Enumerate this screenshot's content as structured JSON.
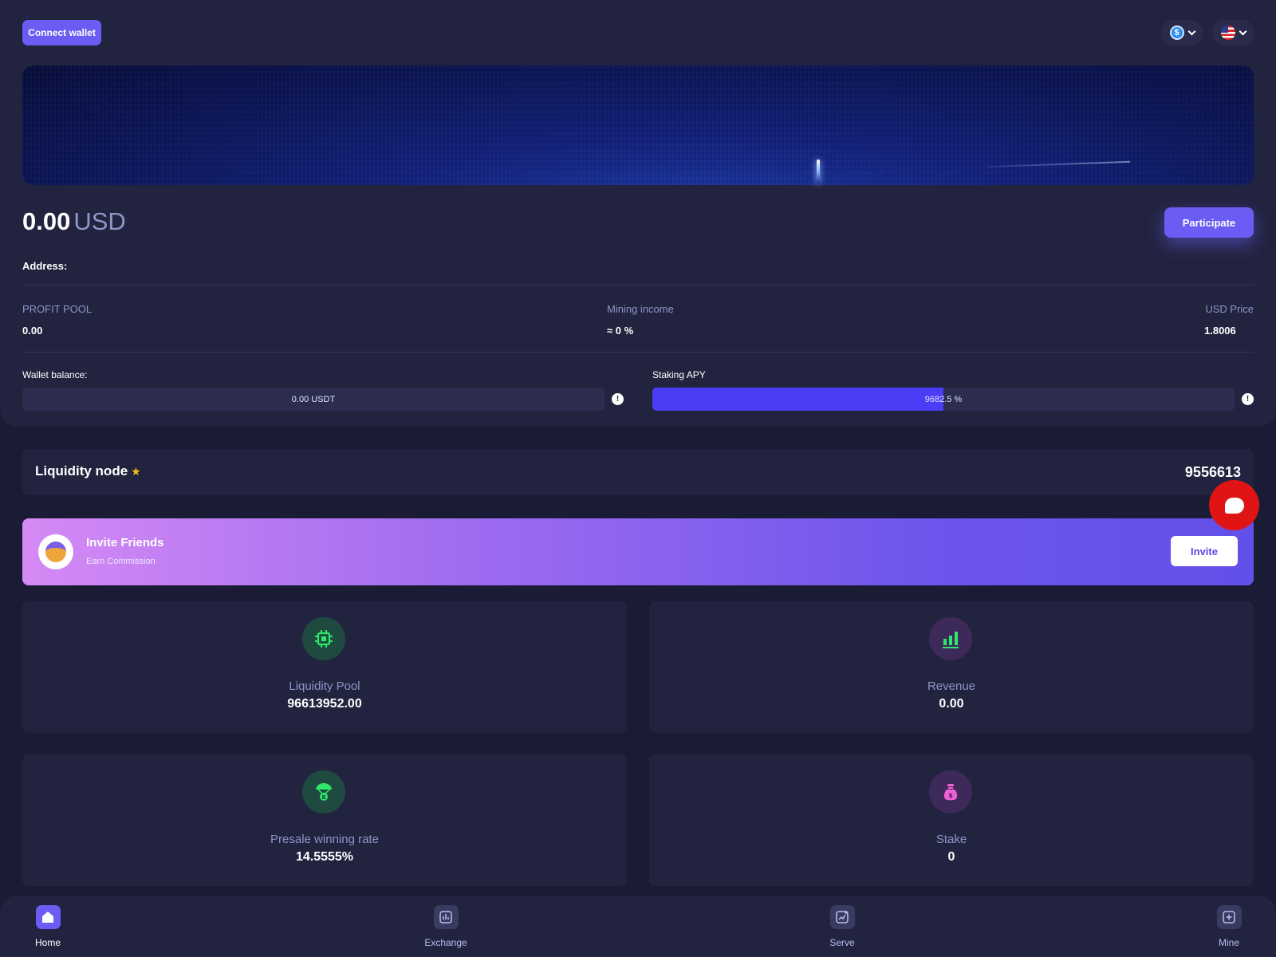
{
  "header": {
    "connect_wallet": "Connect wallet",
    "currency_icon": "dollar-coin-icon",
    "language_icon": "us-flag-icon"
  },
  "balance": {
    "amount": "0.00",
    "unit": "USD",
    "participate": "Participate"
  },
  "address_label": "Address:",
  "stats": {
    "profit_pool_label": "PROFIT POOL",
    "profit_pool_value": "0.00",
    "mining_income_label": "Mining income",
    "mining_income_value": "≈ 0 %",
    "usd_price_label": "USD Price",
    "usd_price_value": "1.8006"
  },
  "bars": {
    "wallet_label": "Wallet balance:",
    "wallet_value": "0.00 USDT",
    "wallet_fill_fraction": 0,
    "staking_label": "Staking APY",
    "staking_value": "9682.5 %",
    "staking_fill_fraction": 0.5
  },
  "node": {
    "title": "Liquidity node",
    "star": "★",
    "value": "9556613"
  },
  "invite": {
    "title": "Invite Friends",
    "subtitle": "Earn Commission",
    "button": "Invite"
  },
  "tiles": [
    {
      "label": "Liquidity Pool",
      "value": "96613952.00",
      "icon": "chip-icon"
    },
    {
      "label": "Revenue",
      "value": "0.00",
      "icon": "bar-chart-icon"
    },
    {
      "label": "Presale winning rate",
      "value": "14.5555%",
      "icon": "bitcoin-parachute-icon"
    },
    {
      "label": "Stake",
      "value": "0",
      "icon": "money-bag-icon"
    }
  ],
  "nav": [
    {
      "label": "Home",
      "icon": "home-icon",
      "active": true
    },
    {
      "label": "Exchange",
      "icon": "exchange-chart-icon",
      "active": false
    },
    {
      "label": "Serve",
      "icon": "serve-chart-icon",
      "active": false
    },
    {
      "label": "Mine",
      "icon": "plus-square-icon",
      "active": false
    }
  ],
  "colors": {
    "accent": "#6b5cf3",
    "background": "#1a1b34",
    "panel": "#22233f",
    "chat_button": "#e01414",
    "icon_green": "#2ee86a",
    "icon_pink": "#f05fd6"
  }
}
